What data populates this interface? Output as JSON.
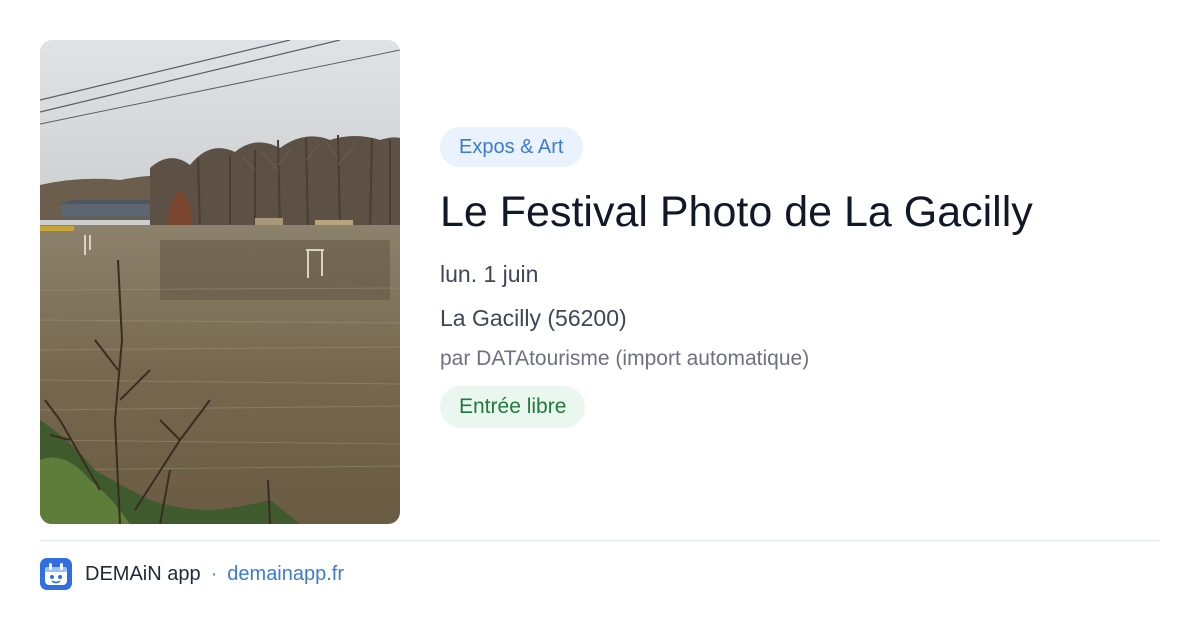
{
  "event": {
    "category": "Expos & Art",
    "title": "Le Festival Photo de La Gacilly",
    "date": "lun. 1 juin",
    "location": "La Gacilly (56200)",
    "author": "par DATAtourisme (import automatique)",
    "price": "Entrée libre",
    "image_icon": "flooded-field-photo"
  },
  "footer": {
    "app_name": "DEMAiN app",
    "separator": "·",
    "url": "demainapp.fr",
    "logo_icon": "demain-app-logo-icon"
  },
  "colors": {
    "category_bg": "#eaf2fd",
    "category_text": "#3b7bd4",
    "price_bg": "#eaf7ee",
    "price_text": "#1f7a3b",
    "link": "#3b7bd4",
    "logo": "#2f6fe0"
  }
}
